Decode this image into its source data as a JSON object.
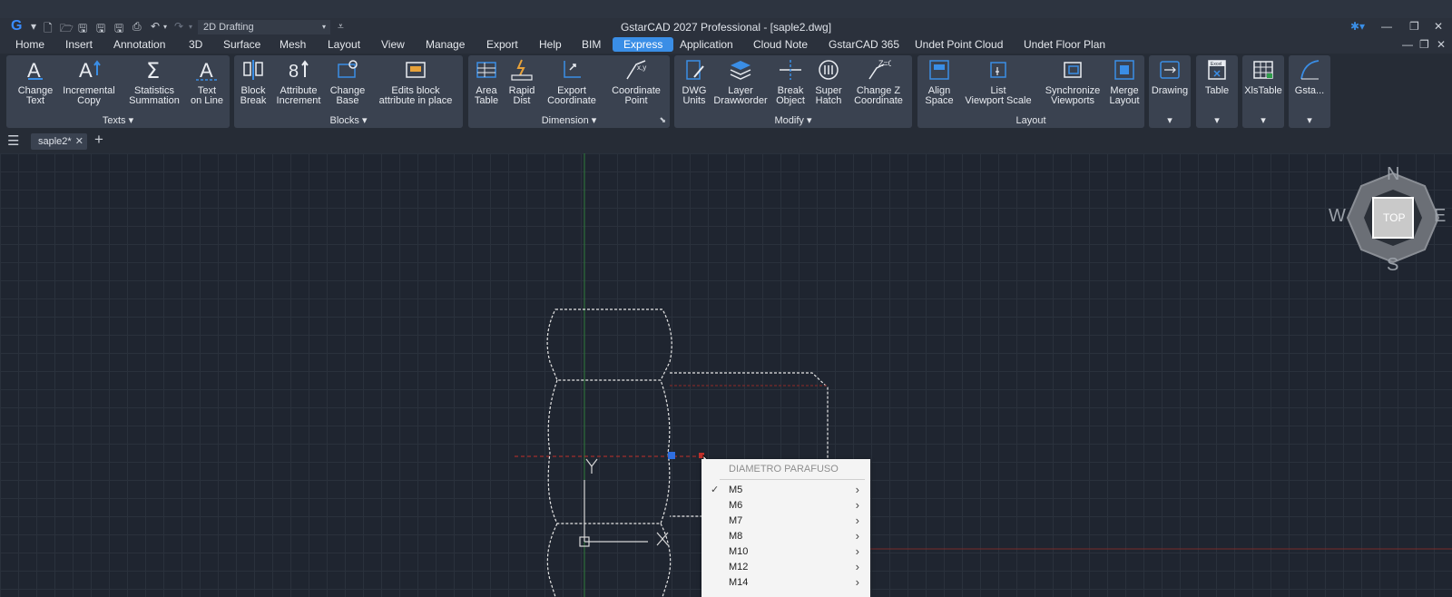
{
  "app": {
    "title": "GstarCAD 2027 Professional - [saple2.dwg]",
    "workspace": "2D Drafting"
  },
  "menubar": {
    "items": [
      "Home",
      "Insert",
      "Annotation",
      "3D",
      "Surface",
      "Mesh",
      "Layout",
      "View",
      "Manage",
      "Export",
      "Help",
      "BIM",
      "Express",
      "Application",
      "Cloud Note",
      "GstarCAD 365",
      "Undet Point Cloud",
      "Undet Floor Plan"
    ],
    "active": "Express"
  },
  "ribbon": {
    "texts": {
      "label": "Texts ▾",
      "tools": [
        {
          "l1": "Change",
          "l2": "Text"
        },
        {
          "l1": "Incremental",
          "l2": "Copy"
        },
        {
          "l1": "Statistics",
          "l2": "Summation"
        },
        {
          "l1": "Text",
          "l2": "on Line"
        }
      ]
    },
    "blocks": {
      "label": "Blocks ▾",
      "tools": [
        {
          "l1": "Block",
          "l2": "Break"
        },
        {
          "l1": "Attribute",
          "l2": "Increment"
        },
        {
          "l1": "Change",
          "l2": "Base"
        },
        {
          "l1": "Edits block",
          "l2": "attribute in place"
        }
      ]
    },
    "dimension": {
      "label": "Dimension ▾",
      "tools": [
        {
          "l1": "Area",
          "l2": "Table"
        },
        {
          "l1": "Rapid",
          "l2": "Dist"
        },
        {
          "l1": "Export",
          "l2": "Coordinate"
        },
        {
          "l1": "Coordinate",
          "l2": "Point"
        }
      ]
    },
    "modify": {
      "label": "Modify ▾",
      "tools": [
        {
          "l1": "DWG",
          "l2": "Units"
        },
        {
          "l1": "Layer",
          "l2": "Drawworder"
        },
        {
          "l1": "Break",
          "l2": "Object"
        },
        {
          "l1": "Super",
          "l2": "Hatch"
        },
        {
          "l1": "Change Z",
          "l2": "Coordinate"
        }
      ]
    },
    "layout": {
      "label": "Layout",
      "tools": [
        {
          "l1": "Align",
          "l2": "Space"
        },
        {
          "l1": "List",
          "l2": "Viewport Scale"
        },
        {
          "l1": "Synchronize",
          "l2": "Viewports"
        },
        {
          "l1": "Merge",
          "l2": "Layout"
        }
      ]
    },
    "extras": [
      {
        "l1": "Drawing"
      },
      {
        "l1": "Table"
      },
      {
        "l1": "XlsTable"
      },
      {
        "l1": "Gsta..."
      }
    ]
  },
  "tabs": {
    "doc": "saple2*"
  },
  "viewcube": {
    "n": "N",
    "s": "S",
    "e": "E",
    "w": "W",
    "face": "TOP"
  },
  "drawing": {
    "ucs_y": "Y"
  },
  "context_menu": {
    "header": "DIAMETRO PARAFUSO",
    "items": [
      "M5",
      "M6",
      "M7",
      "M8",
      "M10",
      "M12",
      "M14"
    ],
    "checked": "M5"
  },
  "colors": {
    "accent": "#3a8ee6",
    "canvas": "#1f2530",
    "grip": "#2f6fe0",
    "redline": "#c0302a"
  }
}
